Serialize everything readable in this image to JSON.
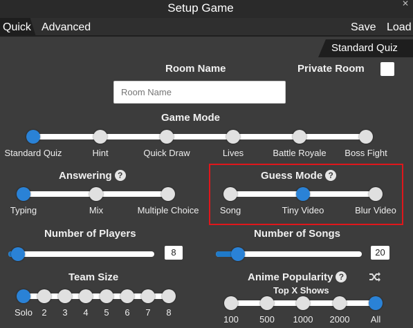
{
  "window": {
    "title": "Setup Game",
    "close_glyph": "✕"
  },
  "tabs": {
    "quick": "Quick",
    "advanced": "Advanced",
    "save": "Save",
    "load": "Load",
    "standard_quiz": "Standard Quiz"
  },
  "room_name": {
    "label": "Room Name",
    "placeholder": "Room Name",
    "value": ""
  },
  "private_room": {
    "label": "Private Room",
    "checked": false
  },
  "game_mode": {
    "label": "Game Mode",
    "options": [
      "Standard Quiz",
      "Hint",
      "Quick Draw",
      "Lives",
      "Battle Royale",
      "Boss Fight"
    ],
    "selected": "Standard Quiz"
  },
  "answering": {
    "label": "Answering",
    "help": "?",
    "options": [
      "Typing",
      "Mix",
      "Multiple Choice"
    ],
    "selected": "Typing"
  },
  "guess_mode": {
    "label": "Guess Mode",
    "help": "?",
    "options": [
      "Song",
      "Tiny Video",
      "Blur Video"
    ],
    "selected": "Tiny Video",
    "highlight_color": "#e0161b"
  },
  "number_of_players": {
    "label": "Number of Players",
    "value": "8"
  },
  "number_of_songs": {
    "label": "Number of Songs",
    "value": "20"
  },
  "team_size": {
    "label": "Team Size",
    "options": [
      "Solo",
      "2",
      "3",
      "4",
      "5",
      "6",
      "7",
      "8"
    ],
    "selected": "Solo"
  },
  "anime_popularity": {
    "label": "Anime Popularity",
    "help": "?",
    "sublabel": "Top X Shows",
    "options": [
      "100",
      "500",
      "1000",
      "2000",
      "All"
    ],
    "selected": "All",
    "shuffle_icon": "shuffle-icon"
  },
  "colors": {
    "accent": "#2a82d6",
    "background": "#3c3c3c",
    "tab_dark": "#1e1e1e"
  }
}
